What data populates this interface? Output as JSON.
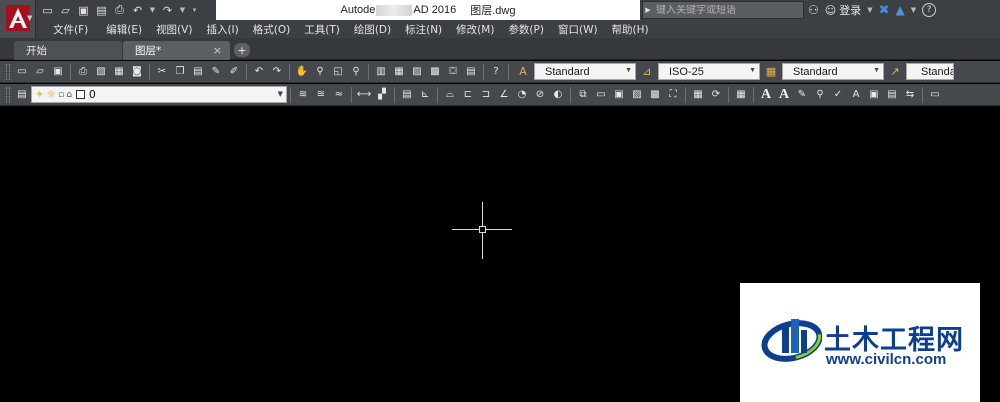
{
  "app": {
    "title_prefix": "Autode",
    "title_suffix": "AD 2016",
    "file_name": "图层.dwg"
  },
  "search": {
    "placeholder": "键入关键字或短语"
  },
  "account": {
    "login_label": "登录"
  },
  "menu": [
    "文件(F)",
    "编辑(E)",
    "视图(V)",
    "插入(I)",
    "格式(O)",
    "工具(T)",
    "绘图(D)",
    "标注(N)",
    "修改(M)",
    "参数(P)",
    "窗口(W)",
    "帮助(H)"
  ],
  "tabs": {
    "start_label": "开始",
    "doc_label": "图层*",
    "close_symbol": "×",
    "add_symbol": "+"
  },
  "toolbar_styles": {
    "text_style": "Standard",
    "dim_style": "ISO-25",
    "table_style": "Standard",
    "multileader_style": "Standa"
  },
  "layer": {
    "current": "0"
  },
  "watermark": {
    "title": "土木工程网",
    "url": "www.civilcn.com",
    "accent": "#0e3f8f"
  },
  "colors": {
    "canvas": "#000000",
    "chrome": "#3c3f44",
    "autocad_red": "#c8102e"
  }
}
